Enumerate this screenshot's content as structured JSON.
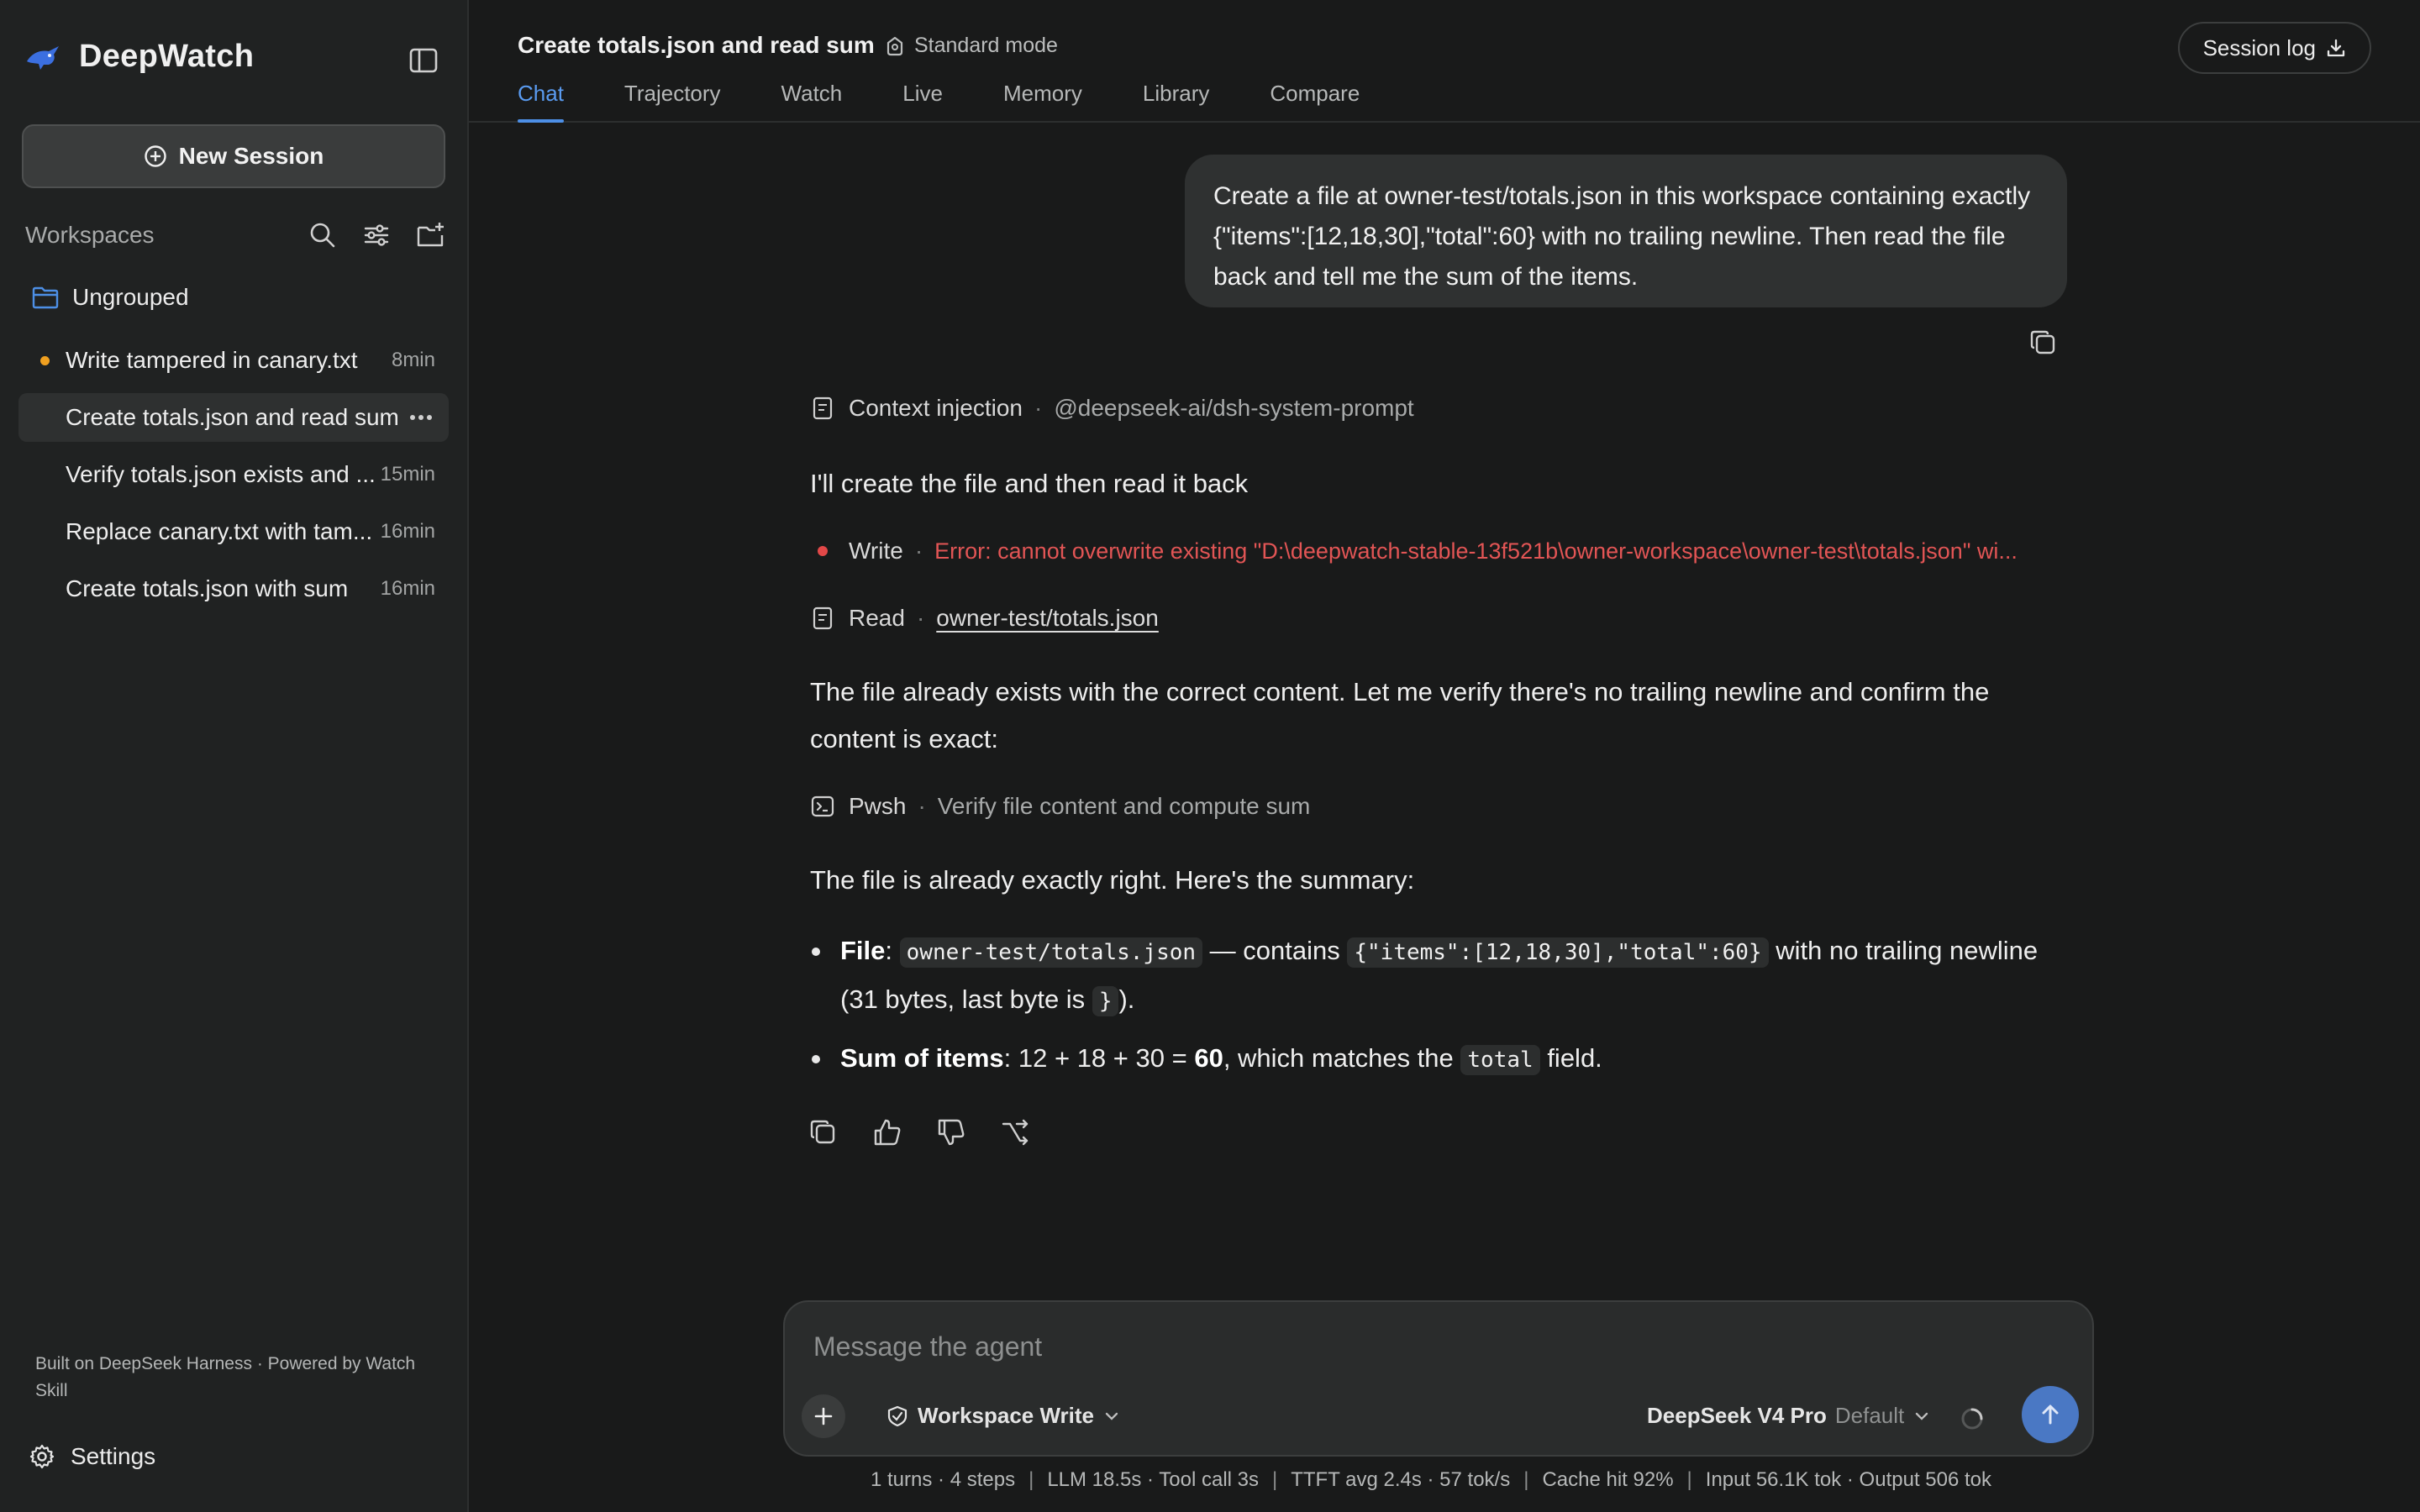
{
  "sidebar": {
    "brand": "DeepWatch",
    "new_session": "New Session",
    "workspaces_title": "Workspaces",
    "group": "Ungrouped",
    "sessions": [
      {
        "label": "Write tampered in canary.txt",
        "time": "8min"
      },
      {
        "label": "Create totals.json and read sum",
        "time": ""
      },
      {
        "label": "Verify totals.json exists and ...",
        "time": "15min"
      },
      {
        "label": "Replace canary.txt with tam...",
        "time": "16min"
      },
      {
        "label": "Create totals.json with sum",
        "time": "16min"
      }
    ],
    "footer": "Built on DeepSeek Harness · Powered by Watch Skill",
    "settings": "Settings"
  },
  "header": {
    "title": "Create totals.json and read sum",
    "mode": "Standard mode",
    "session_log": "Session log",
    "tabs": [
      "Chat",
      "Trajectory",
      "Watch",
      "Live",
      "Memory",
      "Library",
      "Compare"
    ]
  },
  "chat": {
    "user_message": "Create a file at owner-test/totals.json in this workspace containing exactly {\"items\":[12,18,30],\"total\":60} with no trailing newline. Then read the file back and tell me the sum of the items.",
    "context": {
      "label": "Context injection",
      "detail": "@deepseek-ai/dsh-system-prompt"
    },
    "intro": "I'll create the file and then read it back",
    "write_step": {
      "label": "Write",
      "error": "Error: cannot overwrite existing \"D:\\deepwatch-stable-13f521b\\owner-workspace\\owner-test\\totals.json\" wi..."
    },
    "read_step": {
      "label": "Read",
      "file": "owner-test/totals.json"
    },
    "middle": "The file already exists with the correct content. Let me verify there's no trailing newline and confirm the content is exact:",
    "pwsh_step": {
      "label": "Pwsh",
      "detail": "Verify file content and compute sum"
    },
    "summary_intro": "The file is already exactly right. Here's the summary:",
    "bullet1": {
      "bold": "File",
      "colon": ":",
      "code_path": "owner-test/totals.json",
      "text_a": "— contains",
      "code_json": "{\"items\":[12,18,30],\"total\":60}",
      "text_b": "with no trailing newline (31 bytes, last byte is",
      "code_brace": "}",
      "text_c": ")."
    },
    "bullet2": {
      "bold": "Sum of items",
      "text_a": ": 12 + 18 + 30 = ",
      "bold_value": "60",
      "text_b": ", which matches the",
      "code_field": "total",
      "text_c": "field."
    }
  },
  "composer": {
    "placeholder": "Message the agent",
    "permission": "Workspace Write",
    "model": "DeepSeek V4 Pro",
    "model_tag": "Default"
  },
  "stats": {
    "turns": "1 turns · 4 steps",
    "llm": "LLM 18.5s · Tool call 3s",
    "ttft": "TTFT avg 2.4s · 57 tok/s",
    "cache": "Cache hit 92%",
    "tokens": "Input 56.1K tok · Output 506 tok"
  },
  "colors": {
    "accent": "#4d8fe6",
    "error": "#e25555",
    "status_dot": "#f0a020",
    "background": "#191a1a",
    "sidebar": "#202222"
  }
}
